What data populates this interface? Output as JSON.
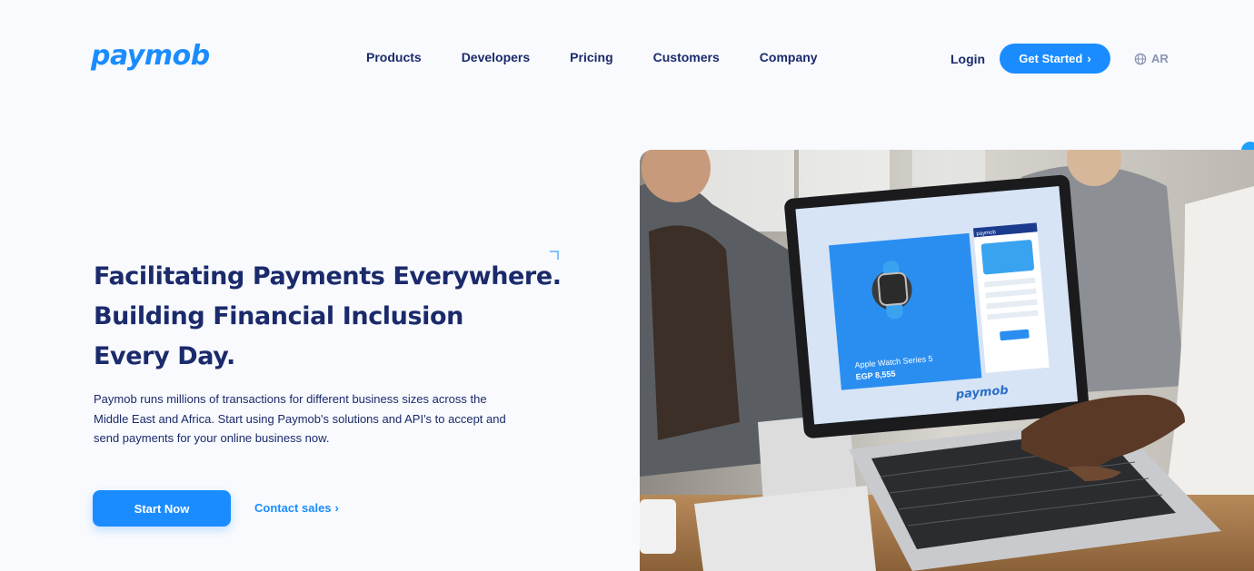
{
  "brand": {
    "logo_text": "paymob",
    "color": "#1a8cff",
    "text_color": "#1b2a6b"
  },
  "nav": {
    "items": [
      {
        "label": "Products"
      },
      {
        "label": "Developers"
      },
      {
        "label": "Pricing"
      },
      {
        "label": "Customers"
      },
      {
        "label": "Company"
      }
    ],
    "login_label": "Login",
    "get_started_label": "Get Started",
    "get_started_chevron": "›",
    "language_icon": "globe-icon",
    "language_label": "AR"
  },
  "hero": {
    "title_lines": [
      "Facilitating Payments Everywhere.",
      "Building Financial Inclusion",
      "Every Day."
    ],
    "description": "Paymob runs millions of transactions for different business sizes across the Middle East and Africa. Start using Paymob's solutions and API's to accept and send payments for your online business now.",
    "primary_cta": "Start Now",
    "secondary_cta": "Contact sales",
    "secondary_chevron": "›"
  },
  "hero_image": {
    "screen_product": "Apple Watch Series 5",
    "screen_price": "EGP 8,555",
    "screen_brand": "paymob",
    "screen_header_brand": "paymob"
  }
}
